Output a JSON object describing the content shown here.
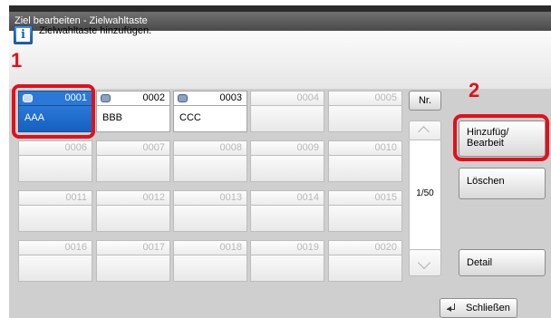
{
  "window": {
    "title": "Ziel bearbeiten - Zielwahltaste"
  },
  "message": "Zielwahltaste hinzufügen.",
  "annotations": {
    "step1": "1",
    "step2": "2"
  },
  "accent_colors": {
    "selected_tile": "#2a79d8",
    "callout_red": "#e0111c"
  },
  "tiles": [
    {
      "number": "0001",
      "name": "AAA",
      "has_icon": true,
      "selected": true
    },
    {
      "number": "0002",
      "name": "BBB",
      "has_icon": true,
      "selected": false
    },
    {
      "number": "0003",
      "name": "CCC",
      "has_icon": true,
      "selected": false
    },
    {
      "number": "0004",
      "name": ""
    },
    {
      "number": "0005",
      "name": ""
    },
    {
      "number": "0006",
      "name": ""
    },
    {
      "number": "0007",
      "name": ""
    },
    {
      "number": "0008",
      "name": ""
    },
    {
      "number": "0009",
      "name": ""
    },
    {
      "number": "0010",
      "name": ""
    },
    {
      "number": "0011",
      "name": ""
    },
    {
      "number": "0012",
      "name": ""
    },
    {
      "number": "0013",
      "name": ""
    },
    {
      "number": "0014",
      "name": ""
    },
    {
      "number": "0015",
      "name": ""
    },
    {
      "number": "0016",
      "name": ""
    },
    {
      "number": "0017",
      "name": ""
    },
    {
      "number": "0018",
      "name": ""
    },
    {
      "number": "0019",
      "name": ""
    },
    {
      "number": "0020",
      "name": ""
    }
  ],
  "nav": {
    "nr_label": "Nr.",
    "page_indicator": "1/50"
  },
  "buttons": {
    "add_edit": [
      "Hinzufüg/",
      "Bearbeit"
    ],
    "delete": "Löschen",
    "detail": "Detail",
    "close": "Schließen"
  }
}
